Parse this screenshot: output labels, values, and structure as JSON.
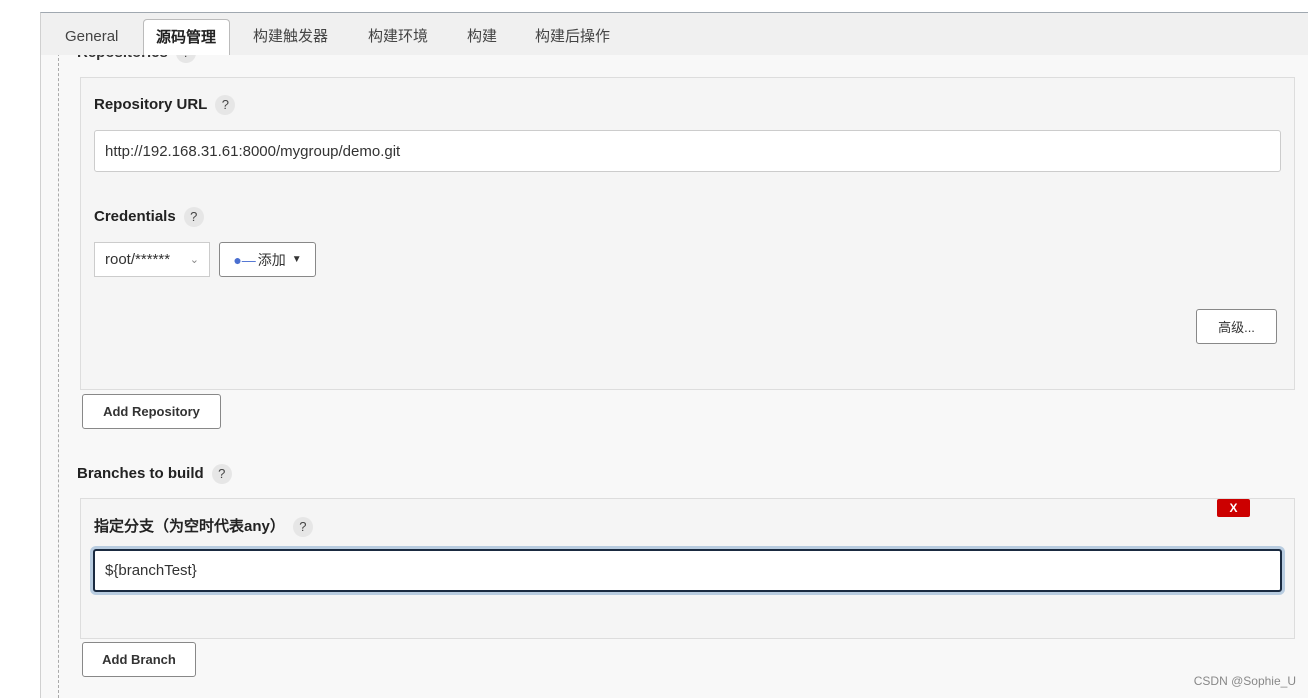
{
  "tabs": [
    {
      "label": "General"
    },
    {
      "label": "源码管理"
    },
    {
      "label": "构建触发器"
    },
    {
      "label": "构建环境"
    },
    {
      "label": "构建"
    },
    {
      "label": "构建后操作"
    }
  ],
  "repositories": {
    "label": "Repositories",
    "help": "?",
    "url_label": "Repository URL",
    "url_help": "?",
    "url_value": "http://192.168.31.61:8000/mygroup/demo.git",
    "credentials_label": "Credentials",
    "credentials_help": "?",
    "credentials_value": "root/******",
    "add_label": "添加",
    "advanced_label": "高级...",
    "add_repository_label": "Add Repository"
  },
  "branches": {
    "label": "Branches to build",
    "help": "?",
    "spec_label": "指定分支（为空时代表any）",
    "spec_help": "?",
    "spec_value": "${branchTest}",
    "delete_label": "X",
    "add_branch_label": "Add Branch"
  },
  "watermark": "CSDN @Sophie_U"
}
